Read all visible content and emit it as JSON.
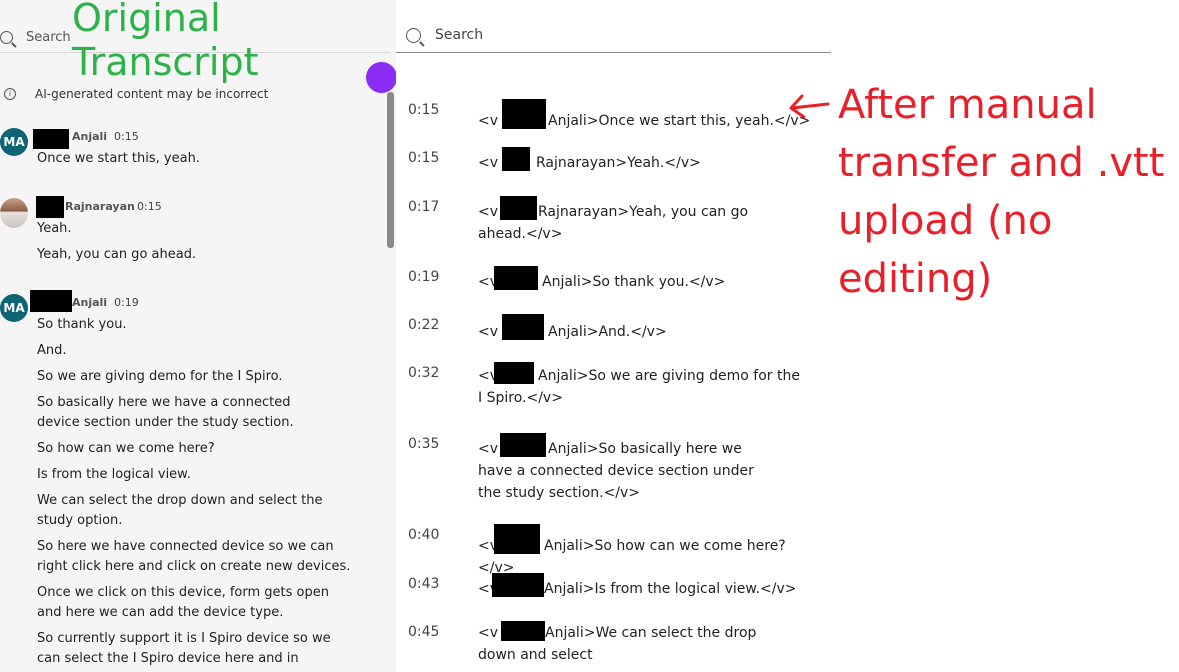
{
  "left_panel": {
    "search_placeholder": "Search",
    "overlay_title": "Original Transcript",
    "ai_notice": "AI-generated content may be incorrect",
    "entries": [
      {
        "initials": "MA",
        "speaker": "Anjali",
        "time": "0:15",
        "lines": [
          "Once we start this, yeah."
        ]
      },
      {
        "initials": "",
        "speaker": "Rajnarayan",
        "time": "0:15",
        "lines": [
          "Yeah.",
          "Yeah, you can go ahead."
        ]
      },
      {
        "initials": "MA",
        "speaker": "Anjali",
        "time": "0:19",
        "lines": [
          "So thank you.",
          "And.",
          "So we are giving demo for the I Spiro.",
          "So basically here we have a connected device section under the study section.",
          "So how can we come here?",
          "Is from the logical view.",
          "We can select the drop down and select the study option.",
          "So here we have connected device so we can right click here and click on create new devices.",
          "Once we click on this device, form gets open and here we can add the device type.",
          "So currently support it is I Spiro device so we can select the I Spiro device here and in hardware"
        ]
      }
    ]
  },
  "right_panel": {
    "search_placeholder": "Search",
    "cues": [
      {
        "time": "0:15",
        "prefix": "<v",
        "text": "Anjali>Once we start this, yeah.</v>"
      },
      {
        "time": "0:15",
        "prefix": "<v",
        "text": "Rajnarayan>Yeah.</v>"
      },
      {
        "time": "0:17",
        "prefix": "<v",
        "text": "Rajnarayan>Yeah, you can go ahead.</v>"
      },
      {
        "time": "0:19",
        "prefix": "<v",
        "text": "Anjali>So thank you.</v>"
      },
      {
        "time": "0:22",
        "prefix": "<v",
        "text": "Anjali>And.</v>"
      },
      {
        "time": "0:32",
        "prefix": "<v",
        "text": "Anjali>So we are giving demo for the I Spiro.</v>"
      },
      {
        "time": "0:35",
        "prefix": "<v",
        "text": "Anjali>So basically here we have a connected device section under the study section.</v>"
      },
      {
        "time": "0:40",
        "prefix": "<v",
        "text": "Anjali>So how can we come here?</v>"
      },
      {
        "time": "0:43",
        "prefix": "<v",
        "text": "Anjali>Is from the logical view.</v>"
      },
      {
        "time": "0:45",
        "prefix": "<v",
        "text": "Anjali>We can select the drop down and select"
      }
    ]
  },
  "annotation": {
    "text": "After manual transfer and .vtt upload (no editing)",
    "color": "#e8202a"
  },
  "colors": {
    "overlay_title": "#2db24a",
    "purple_dot": "#8b2cf5",
    "avatar": "#0c6474"
  }
}
